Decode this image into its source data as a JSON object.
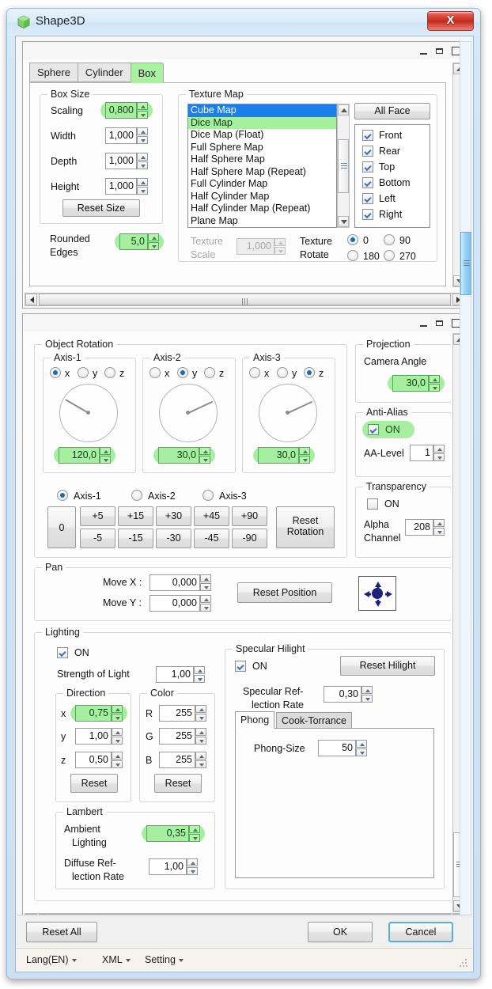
{
  "window": {
    "title": "Shape3D",
    "icon": "cube-icon",
    "close_label": "X"
  },
  "tabs": [
    {
      "label": "Sphere",
      "active": false
    },
    {
      "label": "Cylinder",
      "active": false
    },
    {
      "label": "Box",
      "active": true
    }
  ],
  "box_size": {
    "legend": "Box Size",
    "scaling_label": "Scaling",
    "scaling_value": "0,800",
    "width_label": "Width",
    "width_value": "1,000",
    "depth_label": "Depth",
    "depth_value": "1,000",
    "height_label": "Height",
    "height_value": "1,000",
    "reset_label": "Reset Size"
  },
  "rounded": {
    "label_line1": "Rounded",
    "label_line2": "Edges",
    "value": "5,0"
  },
  "texture_map": {
    "legend": "Texture Map",
    "items": [
      {
        "label": "Cube Map",
        "state": "selected"
      },
      {
        "label": "Dice Map",
        "state": "highlight"
      },
      {
        "label": "Dice Map (Float)",
        "state": "normal"
      },
      {
        "label": "Full Sphere Map",
        "state": "normal"
      },
      {
        "label": "Half Sphere Map",
        "state": "normal"
      },
      {
        "label": "Half Sphere Map (Repeat)",
        "state": "normal"
      },
      {
        "label": "Full Cylinder Map",
        "state": "normal"
      },
      {
        "label": "Half Cylinder Map",
        "state": "normal"
      },
      {
        "label": "Half Cylinder Map (Repeat)",
        "state": "normal"
      },
      {
        "label": "Plane Map",
        "state": "normal"
      }
    ],
    "all_face_label": "All Face",
    "faces": [
      {
        "label": "Front",
        "checked": true
      },
      {
        "label": "Rear",
        "checked": true
      },
      {
        "label": "Top",
        "checked": true
      },
      {
        "label": "Bottom",
        "checked": true
      },
      {
        "label": "Left",
        "checked": true
      },
      {
        "label": "Right",
        "checked": true
      }
    ],
    "texture_scale_label_1": "Texture",
    "texture_scale_label_2": "Scale",
    "texture_scale_value": "1,000",
    "texture_rotate_label_1": "Texture",
    "texture_rotate_label_2": "Rotate",
    "rotate_options": [
      {
        "label": "0",
        "selected": true
      },
      {
        "label": "90",
        "selected": false
      },
      {
        "label": "180",
        "selected": false
      },
      {
        "label": "270",
        "selected": false
      }
    ]
  },
  "object_rotation": {
    "legend": "Object Rotation",
    "axes": [
      {
        "legend": "Axis-1",
        "options": [
          "x",
          "y",
          "z"
        ],
        "selected": "x",
        "angle": "120,0",
        "needle_deg": 120
      },
      {
        "legend": "Axis-2",
        "options": [
          "x",
          "y",
          "z"
        ],
        "selected": "y",
        "angle": "30,0",
        "needle_deg": 30
      },
      {
        "legend": "Axis-3",
        "options": [
          "x",
          "y",
          "z"
        ],
        "selected": "z",
        "angle": "30,0",
        "needle_deg": 30
      }
    ],
    "axis_picker": [
      {
        "label": "Axis-1",
        "selected": true
      },
      {
        "label": "Axis-2",
        "selected": false
      },
      {
        "label": "Axis-3",
        "selected": false
      }
    ],
    "zero_label": "0",
    "plus_steps": [
      "+5",
      "+15",
      "+30",
      "+45",
      "+90"
    ],
    "minus_steps": [
      "-5",
      "-15",
      "-30",
      "-45",
      "-90"
    ],
    "reset_label_1": "Reset",
    "reset_label_2": "Rotation"
  },
  "projection": {
    "legend": "Projection",
    "camera_angle_label": "Camera Angle",
    "camera_angle_value": "30,0"
  },
  "anti_alias": {
    "legend": "Anti-Alias",
    "on_label": "ON",
    "on_checked": true,
    "level_label": "AA-Level",
    "level_value": "1"
  },
  "transparency": {
    "legend": "Transparency",
    "on_label": "ON",
    "on_checked": false,
    "alpha_label_1": "Alpha",
    "alpha_label_2": "Channel",
    "alpha_value": "208"
  },
  "pan": {
    "legend": "Pan",
    "move_x_label": "Move X :",
    "move_x_value": "0,000",
    "move_y_label": "Move Y :",
    "move_y_value": "0,000",
    "reset_label": "Reset Position",
    "compass_name": "pan-compass"
  },
  "lighting": {
    "legend": "Lighting",
    "on_label": "ON",
    "on_checked": true,
    "strength_label": "Strength of Light",
    "strength_value": "1,00",
    "direction": {
      "legend": "Direction",
      "x_label": "x",
      "x_value": "0,75",
      "y_label": "y",
      "y_value": "1,00",
      "z_label": "z",
      "z_value": "0,50",
      "reset_label": "Reset"
    },
    "color": {
      "legend": "Color",
      "r_label": "R",
      "r_value": "255",
      "g_label": "G",
      "g_value": "255",
      "b_label": "B",
      "b_value": "255",
      "reset_label": "Reset"
    }
  },
  "specular": {
    "legend": "Specular Hilight",
    "on_label": "ON",
    "on_checked": true,
    "reset_label": "Reset Hilight",
    "rate_label_1": "Specular Ref-",
    "rate_label_2": "lection Rate",
    "rate_value": "0,30",
    "tabs": [
      {
        "label": "Phong",
        "active": true
      },
      {
        "label": "Cook-Torrance",
        "active": false
      }
    ],
    "phong_size_label": "Phong-Size",
    "phong_size_value": "50"
  },
  "lambert": {
    "legend": "Lambert",
    "ambient_label_1": "Ambient",
    "ambient_label_2": "Lighting",
    "ambient_value": "0,35",
    "diffuse_label_1": "Diffuse Ref-",
    "diffuse_label_2": "lection Rate",
    "diffuse_value": "1,00"
  },
  "footer": {
    "reset_all_label": "Reset All",
    "ok_label": "OK",
    "cancel_label": "Cancel"
  },
  "statusbar": {
    "lang_label": "Lang(EN)",
    "xml_label": "XML",
    "setting_label": "Setting"
  },
  "colors": {
    "accent_green": "#a6efa0",
    "select_blue": "#1a7fe8",
    "close_red": "#c0281d",
    "default_btn_border": "#5aade0"
  }
}
